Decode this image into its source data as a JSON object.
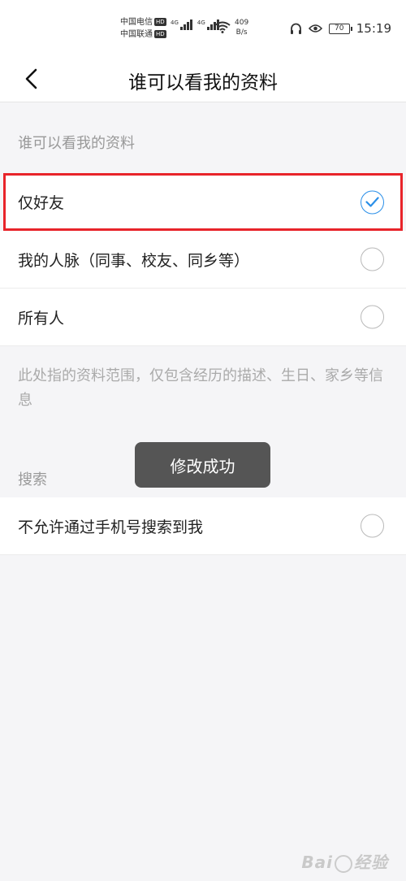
{
  "status_bar": {
    "carrier1": "中国电信",
    "carrier2": "中国联通",
    "hd": "HD",
    "net1": "4G",
    "net2": "4G",
    "speed_value": "409",
    "speed_unit": "B/s",
    "battery": "70",
    "time": "15:19",
    "icons": [
      "headset-icon",
      "eye-icon",
      "wifi-icon",
      "signal-icon",
      "battery-icon"
    ]
  },
  "nav": {
    "title": "谁可以看我的资料",
    "back_icon": "chevron-left-icon"
  },
  "visibility": {
    "header": "谁可以看我的资料",
    "options": [
      {
        "label": "仅好友",
        "selected": true
      },
      {
        "label": "我的人脉（同事、校友、同乡等）",
        "selected": false
      },
      {
        "label": "所有人",
        "selected": false
      }
    ],
    "description": "此处指的资料范围，仅包含经历的描述、生日、家乡等信息"
  },
  "search": {
    "header": "搜索",
    "options": [
      {
        "label": "不允许通过手机号搜索到我",
        "selected": false
      }
    ]
  },
  "toast": {
    "message": "修改成功"
  },
  "watermark": {
    "text1": "Bai",
    "text2": "经验"
  },
  "colors": {
    "accent_blue": "#2a8fe8",
    "highlight_red": "#e8242a",
    "background": "#f5f5f7"
  }
}
